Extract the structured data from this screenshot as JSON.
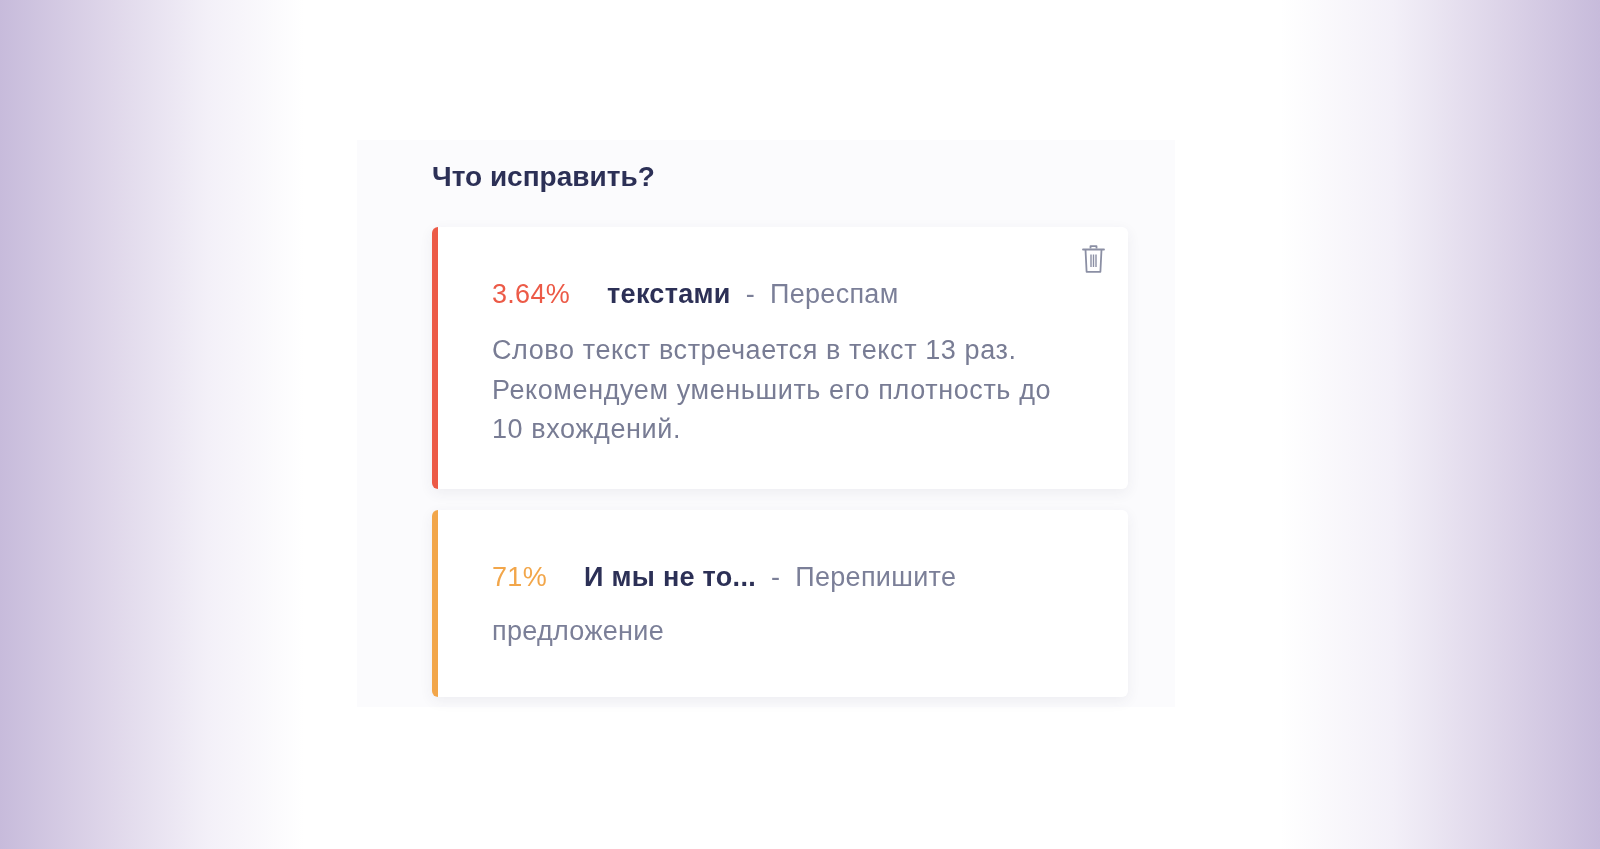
{
  "title": "Что исправить?",
  "issues": [
    {
      "color": "#ec5a47",
      "percent": "3.64%",
      "word": "текстами",
      "separator": "-",
      "type": "Переспам",
      "description": "Слово текст встречается в текст 13 раз. Рекомендуем уменьшить его плотность до 10 вхождений.",
      "show_delete": true
    },
    {
      "color": "#f2a64a",
      "percent": "71%",
      "word": "И мы не то...",
      "separator": "-",
      "type": "Перепишите предложение",
      "show_delete": false
    }
  ]
}
